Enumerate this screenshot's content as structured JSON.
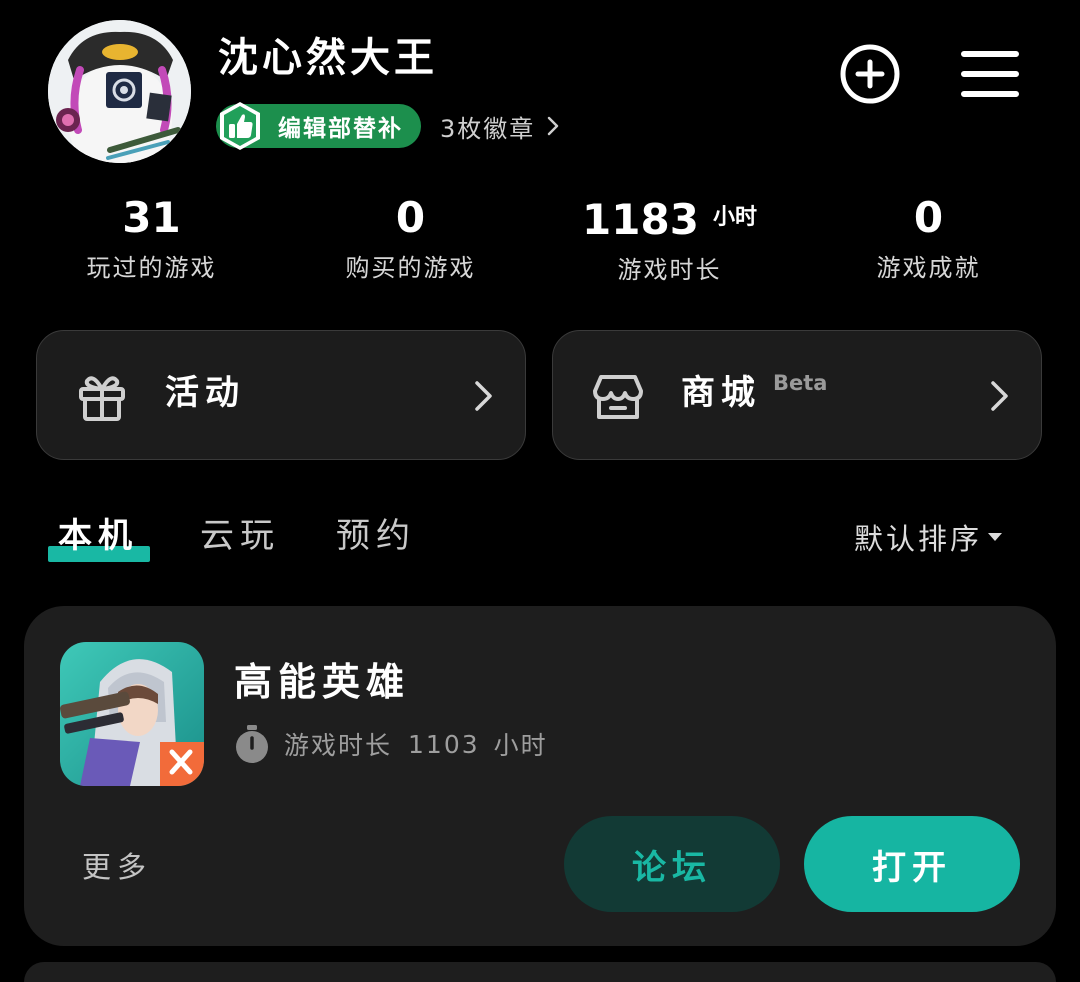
{
  "profile": {
    "username": "沈心然大王",
    "badge_label": "编辑部替补",
    "badge_count": "3枚徽章"
  },
  "stats": [
    {
      "value": "31",
      "unit": "",
      "label": "玩过的游戏"
    },
    {
      "value": "0",
      "unit": "",
      "label": "购买的游戏"
    },
    {
      "value": "1183",
      "unit": "小时",
      "label": "游戏时长"
    },
    {
      "value": "0",
      "unit": "",
      "label": "游戏成就"
    }
  ],
  "cards": {
    "activity": {
      "label": "活动",
      "icon": "gift-icon"
    },
    "store": {
      "label": "商城",
      "sup": "Beta",
      "icon": "store-icon"
    }
  },
  "tabs": [
    {
      "label": "本机",
      "active": true
    },
    {
      "label": "云玩",
      "active": false
    },
    {
      "label": "预约",
      "active": false
    }
  ],
  "sort": {
    "label": "默认排序"
  },
  "game": {
    "title": "高能英雄",
    "time_label": "游戏时长",
    "time_value": "1103",
    "time_unit": "小时",
    "more_label": "更多",
    "forum_label": "论坛",
    "open_label": "打开"
  },
  "colors": {
    "background": "#000000",
    "card": "#1c1c1c",
    "accent": "#19b8a4",
    "badge_green": "#1c8f4d"
  }
}
